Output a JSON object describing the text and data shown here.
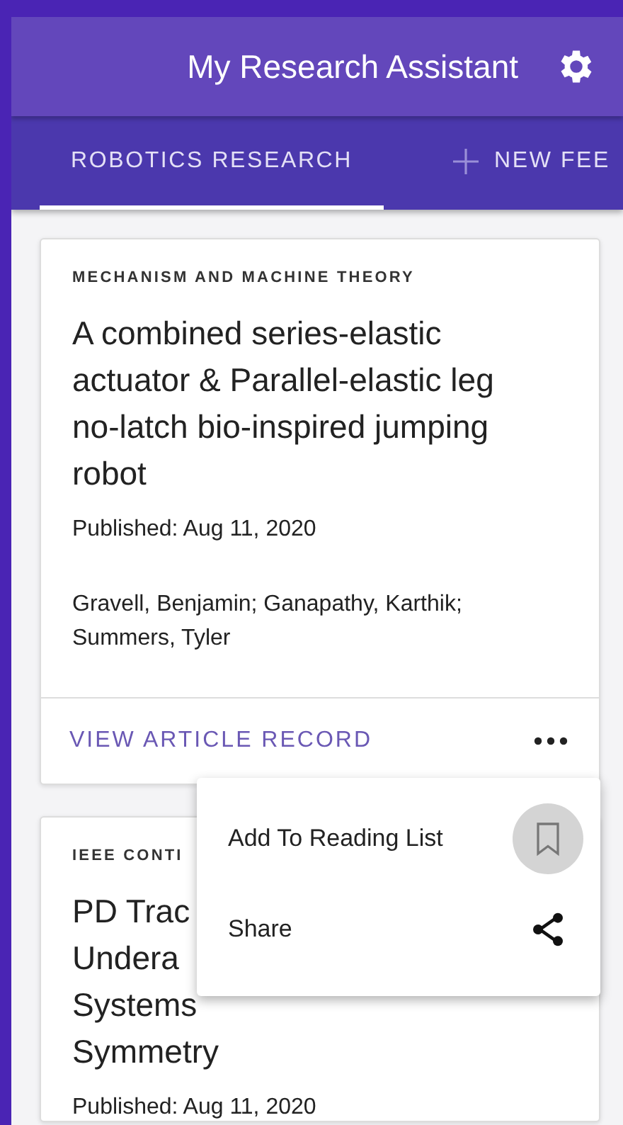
{
  "app_bar": {
    "title": "My Research Assistant"
  },
  "tabs": [
    {
      "label": "ROBOTICS RESEARCH",
      "selected": true,
      "kind": "feed"
    },
    {
      "label": "NEW FEE",
      "selected": false,
      "kind": "add"
    }
  ],
  "articles": [
    {
      "journal": "MECHANISM AND MACHINE THEORY",
      "title_lines": [
        "A combined series-elastic",
        "actuator & Parallel-elastic leg",
        "no-latch bio-inspired jumping",
        "robot"
      ],
      "published": "Published: Aug 11, 2020",
      "authors": "Gravell, Benjamin; Ganapathy, Karthik; Summers, Tyler",
      "action": "VIEW ARTICLE RECORD"
    },
    {
      "journal": "IEEE CONTI",
      "title_lines": [
        "PD Trac",
        "Undera",
        "Systems",
        "Symmetry"
      ],
      "published": "Published: Aug 11, 2020"
    }
  ],
  "menu": {
    "items": [
      {
        "label": "Add To Reading List",
        "kind": "bookmark",
        "selected": true
      },
      {
        "label": "Share",
        "kind": "share",
        "selected": false
      }
    ]
  }
}
